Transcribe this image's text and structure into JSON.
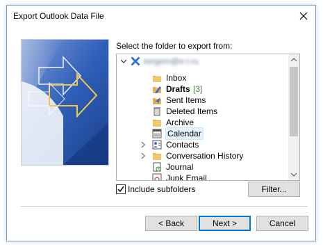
{
  "window": {
    "title": "Export Outlook Data File"
  },
  "prompt": "Select the folder to export from:",
  "tree": {
    "root": {
      "label": "sergem@e-l.ru",
      "icon": "mailbox-icon"
    },
    "items": [
      {
        "label": "Inbox",
        "icon": "folder-inbox-icon"
      },
      {
        "label": "Drafts",
        "count": "[3]",
        "bold": true,
        "icon": "drafts-icon"
      },
      {
        "label": "Sent Items",
        "icon": "sent-items-icon"
      },
      {
        "label": "Deleted Items",
        "icon": "trash-icon"
      },
      {
        "label": "Archive",
        "icon": "folder-icon"
      },
      {
        "label": "Calendar",
        "icon": "calendar-icon",
        "selected": true
      },
      {
        "label": "Contacts",
        "icon": "contacts-icon",
        "expandable": true
      },
      {
        "label": "Conversation History",
        "icon": "folder-icon",
        "expandable": true
      },
      {
        "label": "Journal",
        "icon": "journal-icon"
      },
      {
        "label": "Junk Email",
        "icon": "junk-icon"
      }
    ]
  },
  "include_subfolders": {
    "label": "Include subfolders",
    "checked": true
  },
  "buttons": {
    "filter": "Filter...",
    "back": "< Back",
    "next": "Next >",
    "cancel": "Cancel"
  },
  "colors": {
    "accent": "#0078d7",
    "selection": "#e5f1fb",
    "count": "#3a8a35"
  }
}
